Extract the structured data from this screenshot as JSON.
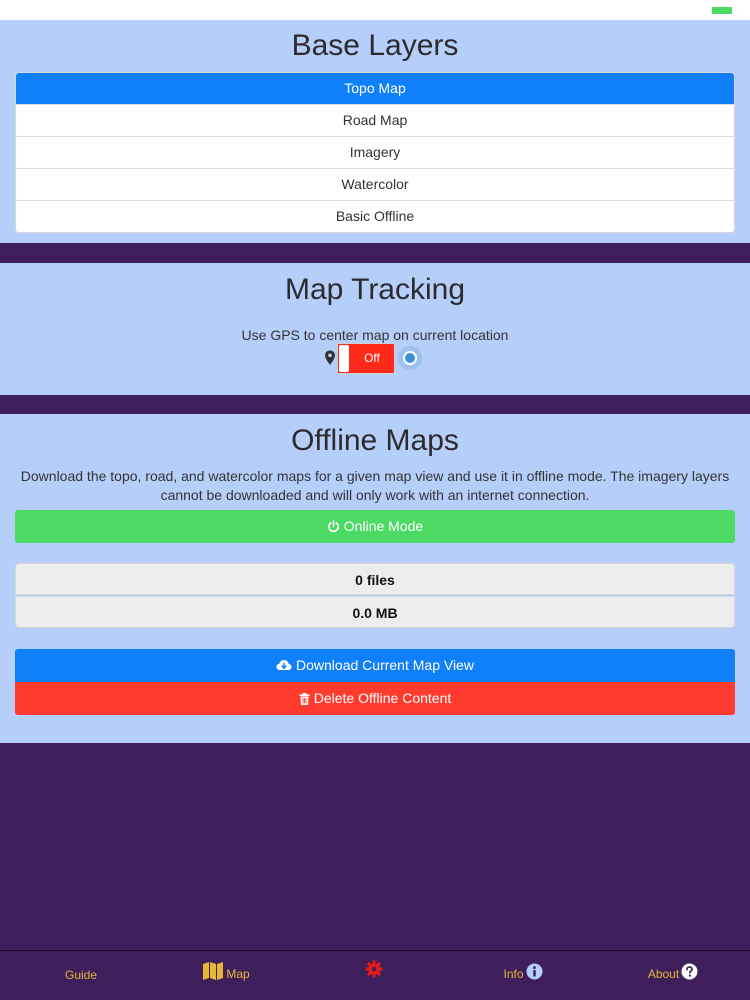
{
  "colors": {
    "panel_bg": "#b6cffa",
    "page_bg": "#3e1f5c",
    "active_blue": "#0f7ffa",
    "online_green": "#4cd964",
    "delete_red": "#ff3b30",
    "toggle_off_red": "#ff2a1a",
    "tab_gold": "#e6b733"
  },
  "base_layers": {
    "title": "Base Layers",
    "items": [
      {
        "label": "Topo Map",
        "active": true
      },
      {
        "label": "Road Map",
        "active": false
      },
      {
        "label": "Imagery",
        "active": false
      },
      {
        "label": "Watercolor",
        "active": false
      },
      {
        "label": "Basic Offline",
        "active": false
      }
    ]
  },
  "map_tracking": {
    "title": "Map Tracking",
    "description": "Use GPS to center map on current location",
    "toggle_label": "Off",
    "toggle_state": "off",
    "icon": "map-pin-icon"
  },
  "offline_maps": {
    "title": "Offline Maps",
    "description": "Download the topo, road, and watercolor maps for a given map view and use it in offline mode. The imagery layers cannot be downloaded and will only work with an internet connection.",
    "online_mode_label": "Online Mode",
    "files_count": "0 files",
    "size": "0.0 MB",
    "download_label": "Download Current Map View",
    "delete_label": "Delete Offline Content"
  },
  "tabbar": {
    "guide": "Guide",
    "map": "Map",
    "info": "Info",
    "about": "About"
  }
}
